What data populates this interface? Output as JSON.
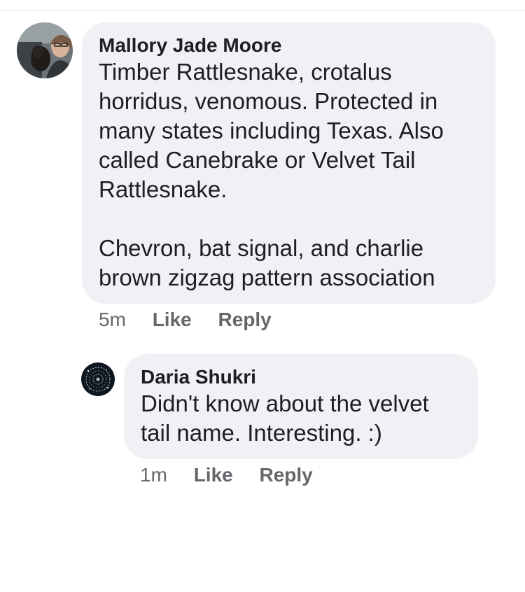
{
  "comments": [
    {
      "author": "Mallory Jade Moore",
      "text": "Timber Rattlesnake, crotalus horridus, venomous. Protected in many states including Texas. Also called Canebrake or Velvet Tail Rattlesnake.\n\nChevron, bat signal, and charlie brown zigzag pattern association",
      "time": "5m",
      "like_label": "Like",
      "reply_label": "Reply",
      "avatar_icon": "profile-photo-woman-with-dog"
    },
    {
      "author": "Daria Shukri",
      "text": "Didn't know about the velvet tail name. Interesting. :)",
      "time": "1m",
      "like_label": "Like",
      "reply_label": "Reply",
      "avatar_icon": "profile-photo-dark-pattern"
    }
  ],
  "colors": {
    "bubble": "#f0f1f4",
    "text": "#1c1e21",
    "secondary_text": "#65676b",
    "divider": "#dadde1"
  }
}
